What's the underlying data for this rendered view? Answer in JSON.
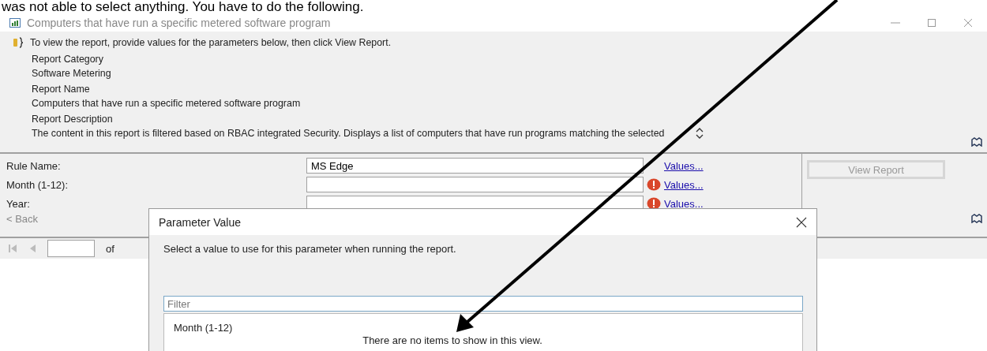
{
  "document_text": "was not able to select anything. You have to do the following.",
  "window": {
    "title": "Computers that have run a specific metered software program"
  },
  "info": {
    "message": "To view the report, provide values for the parameters below, then click View Report.",
    "fields": [
      {
        "label": "Report Category",
        "value": "Software Metering"
      },
      {
        "label": "Report Name",
        "value": "Computers that have run a specific metered software program"
      },
      {
        "label": "Report Description",
        "value": "The content in this report is filtered based on RBAC integrated Security. Displays a list of computers that have run programs matching the selected"
      }
    ]
  },
  "parameters": [
    {
      "label": "Rule Name:",
      "value": "MS Edge",
      "error": false,
      "link": "Values..."
    },
    {
      "label": "Month (1-12):",
      "error": true,
      "link": "Values..."
    },
    {
      "label": "Year:",
      "error": true,
      "link": "Values..."
    }
  ],
  "back_link": "< Back",
  "view_report_button": {
    "label": "View Report",
    "disabled": true
  },
  "pager": {
    "of_label": "of"
  },
  "dialog": {
    "title": "Parameter Value",
    "instruction": "Select a value to use for this parameter when running the report.",
    "filter": {
      "placeholder": "Filter"
    },
    "list": {
      "column": "Month (1-12)",
      "empty_message": "There are no items to show in this view."
    }
  }
}
